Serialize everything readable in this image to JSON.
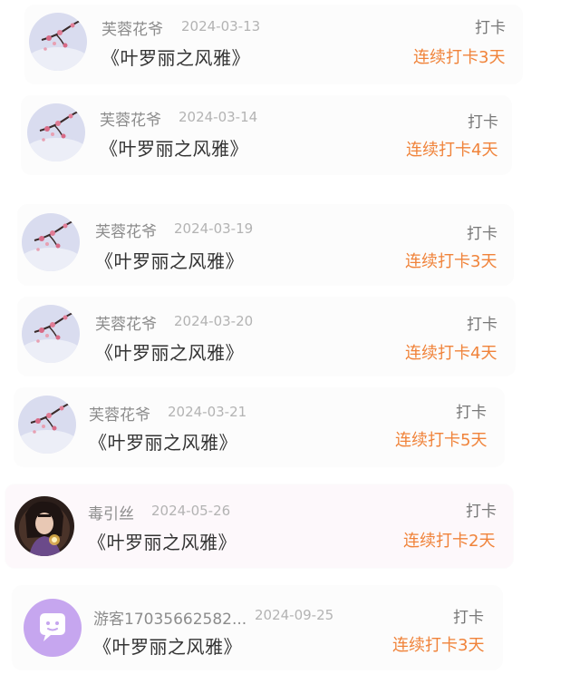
{
  "colors": {
    "streak": "#f0833a",
    "name": "#8c8c8c",
    "date": "#b3b3b3",
    "title": "#333333",
    "action": "#777777"
  },
  "entries": [
    {
      "user": "芙蓉花爷",
      "date": "2024-03-13",
      "title": "《叶罗丽之风雅》",
      "action": "打卡",
      "streak": "连续打卡3天",
      "avatar": "plum-blossom-avatar"
    },
    {
      "user": "芙蓉花爷",
      "date": "2024-03-14",
      "title": "《叶罗丽之风雅》",
      "action": "打卡",
      "streak": "连续打卡4天",
      "avatar": "plum-blossom-avatar"
    },
    {
      "user": "芙蓉花爷",
      "date": "2024-03-19",
      "title": "《叶罗丽之风雅》",
      "action": "打卡",
      "streak": "连续打卡3天",
      "avatar": "plum-blossom-avatar"
    },
    {
      "user": "芙蓉花爷",
      "date": "2024-03-20",
      "title": "《叶罗丽之风雅》",
      "action": "打卡",
      "streak": "连续打卡4天",
      "avatar": "plum-blossom-avatar"
    },
    {
      "user": "芙蓉花爷",
      "date": "2024-03-21",
      "title": "《叶罗丽之风雅》",
      "action": "打卡",
      "streak": "连续打卡5天",
      "avatar": "plum-blossom-avatar"
    },
    {
      "user": "毒引丝",
      "date": "2024-05-26",
      "title": "《叶罗丽之风雅》",
      "action": "打卡",
      "streak": "连续打卡2天",
      "avatar": "character-portrait-avatar"
    },
    {
      "user": "游客17035662582...",
      "date": "2024-09-25",
      "title": "《叶罗丽之风雅》",
      "action": "打卡",
      "streak": "连续打卡3天",
      "avatar": "chat-bubble-avatar"
    }
  ]
}
